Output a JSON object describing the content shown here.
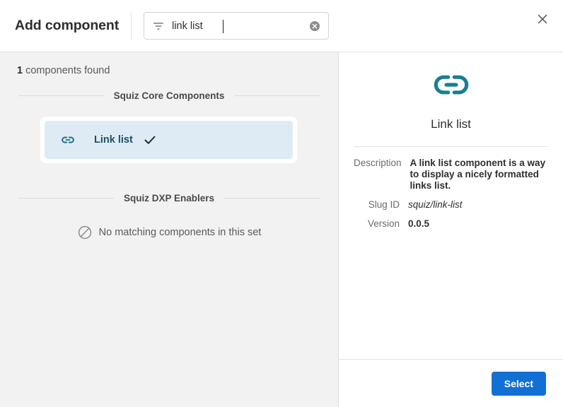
{
  "header": {
    "title": "Add component",
    "filter_icon": "filter-icon",
    "close_icon": "close-icon",
    "search": {
      "value": "link list",
      "placeholder": "",
      "clear_icon": "clear-circle-icon"
    }
  },
  "left_panel": {
    "result_count": "1",
    "result_label": " components found",
    "sections": [
      {
        "label": "Squiz Core Components",
        "empty": false,
        "items": [
          {
            "label": "Link list",
            "icon": "link-icon",
            "selected": true,
            "check_icon": "check-icon"
          }
        ]
      },
      {
        "label": "Squiz DXP Enablers",
        "empty": true,
        "empty_icon": "no-entry-icon",
        "empty_text": "No matching components in this set",
        "items": []
      }
    ]
  },
  "detail_panel": {
    "icon": "link-icon",
    "title": "Link list",
    "fields": [
      {
        "key": "Description",
        "value": "A link list component is a way to display a nicely formatted links list.",
        "style": "bold"
      },
      {
        "key": "Slug ID",
        "value": "squiz/link-list",
        "style": "italic"
      },
      {
        "key": "Version",
        "value": "0.0.5",
        "style": "bold"
      }
    ]
  },
  "footer": {
    "select_label": "Select"
  },
  "colors": {
    "accent_teal": "#1b7e93",
    "selected_card_bg": "#dfebf4",
    "selected_card_text": "#1d4f66",
    "primary_button": "#1270d4",
    "panel_bg": "#f2f2f2"
  }
}
